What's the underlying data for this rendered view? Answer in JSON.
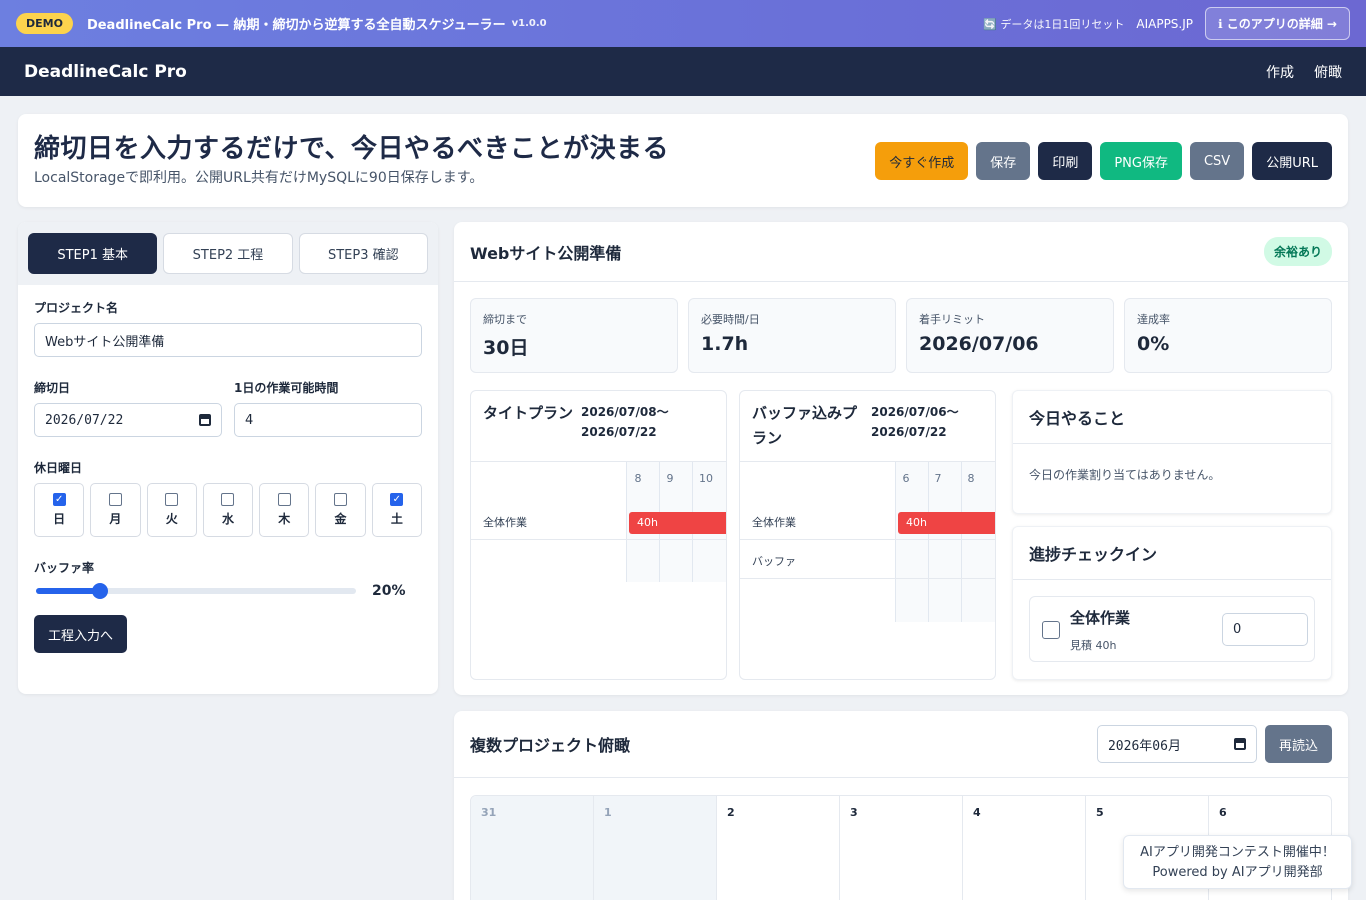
{
  "demo": {
    "badge": "DEMO",
    "title": "DeadlineCalc Pro — 納期・締切から逆算する全自動スケジューラー",
    "version": "v1.0.0",
    "reset": "🔄 データは1日1回リセット",
    "site": "AIAPPS.JP",
    "detail_button": "ℹ このアプリの詳細 →"
  },
  "header": {
    "brand": "DeadlineCalc Pro",
    "nav": [
      "作成",
      "俯瞰"
    ]
  },
  "hero": {
    "title": "締切日を入力するだけで、今日やるべきことが決まる",
    "subtitle": "LocalStorageで即利用。公開URL共有だけMySQLに90日保存します。",
    "actions": [
      "今すぐ作成",
      "保存",
      "印刷",
      "PNG保存",
      "CSV",
      "公開URL"
    ]
  },
  "steps": {
    "tabs": [
      "STEP1 基本",
      "STEP2 工程",
      "STEP3 確認"
    ],
    "active": 0
  },
  "form": {
    "project_label": "プロジェクト名",
    "project_value": "Webサイト公開準備",
    "deadline_label": "締切日",
    "deadline_value": "2026/07/22",
    "hours_label": "1日の作業可能時間",
    "hours_value": "4",
    "holidays_label": "休日曜日",
    "weekdays": [
      {
        "label": "日",
        "checked": true
      },
      {
        "label": "月",
        "checked": false
      },
      {
        "label": "火",
        "checked": false
      },
      {
        "label": "水",
        "checked": false
      },
      {
        "label": "木",
        "checked": false
      },
      {
        "label": "金",
        "checked": false
      },
      {
        "label": "土",
        "checked": true
      }
    ],
    "buffer_label": "バッファ率",
    "buffer_value": 20,
    "buffer_display": "20%",
    "next_button": "工程入力へ"
  },
  "project": {
    "title": "Webサイト公開準備",
    "status": "余裕あり",
    "stats": [
      {
        "label": "締切まで",
        "value": "30日"
      },
      {
        "label": "必要時間/日",
        "value": "1.7h"
      },
      {
        "label": "着手リミット",
        "value": "2026/07/06"
      },
      {
        "label": "達成率",
        "value": "0%"
      }
    ]
  },
  "plans": [
    {
      "title": "タイトプラン",
      "range_start": "2026/07/08〜",
      "range_end": "2026/07/22",
      "days": [
        "8",
        "9",
        "10"
      ],
      "rows": [
        {
          "label": "全体作業",
          "bar": "40h"
        }
      ]
    },
    {
      "title": "バッファ込みプラン",
      "range_start": "2026/07/06〜",
      "range_end": "2026/07/22",
      "days": [
        "6",
        "7",
        "8"
      ],
      "rows": [
        {
          "label": "全体作業",
          "bar": "40h"
        },
        {
          "label": "バッファ",
          "bar": ""
        }
      ]
    }
  ],
  "today": {
    "title": "今日やること",
    "empty": "今日の作業割り当てはありません。"
  },
  "checkin": {
    "title": "進捗チェックイン",
    "item_name": "全体作業",
    "item_estimate": "見積 40h",
    "item_value": "0"
  },
  "overview": {
    "title": "複数プロジェクト俯瞰",
    "month": "2026年06月",
    "reload": "再読込",
    "cells": [
      {
        "day": "31",
        "muted": true
      },
      {
        "day": "1",
        "muted": true
      },
      {
        "day": "2",
        "muted": false
      },
      {
        "day": "3",
        "muted": false
      },
      {
        "day": "4",
        "muted": false
      },
      {
        "day": "5",
        "muted": false
      },
      {
        "day": "6",
        "muted": false
      }
    ]
  },
  "contest": {
    "line1": "AIアプリ開発コンテスト開催中！",
    "line2": "Powered by AIアプリ開発部"
  },
  "colors": {
    "navy": "#1e2a47",
    "amber": "#f59e0b",
    "green": "#10b981",
    "slate": "#64748b",
    "bar_red": "#ef4444",
    "accent_blue": "#2563eb"
  }
}
